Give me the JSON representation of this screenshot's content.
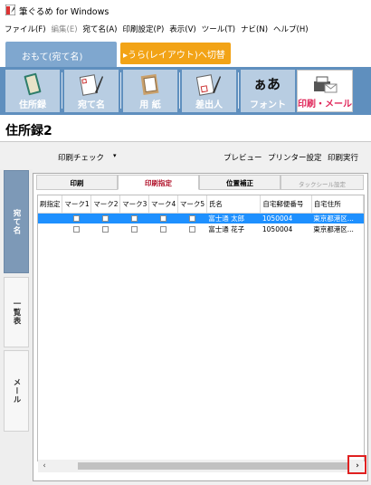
{
  "window": {
    "title": "筆ぐるめ for Windows"
  },
  "menu": [
    {
      "label": "ファイル(F)",
      "enabled": true
    },
    {
      "label": "編集(E)",
      "enabled": false
    },
    {
      "label": "宛て名(A)",
      "enabled": true
    },
    {
      "label": "印刷設定(P)",
      "enabled": true
    },
    {
      "label": "表示(V)",
      "enabled": true
    },
    {
      "label": "ツール(T)",
      "enabled": true
    },
    {
      "label": "ナビ(N)",
      "enabled": true
    },
    {
      "label": "ヘルプ(H)",
      "enabled": true
    }
  ],
  "mode_tabs": {
    "front": "おもて(宛て名)",
    "back": "▸うら(レイアウト)へ切替"
  },
  "toolbar": {
    "address_book": "住所録",
    "addressee": "宛て名",
    "paper": "用 紙",
    "sender": "差出人",
    "font": "フォント",
    "font_glyph": "ぁあ",
    "print_mail": "印刷・メール"
  },
  "book": {
    "title": "住所録2"
  },
  "subbar": {
    "print_check": "印刷チェック",
    "dropdown_arrow": "▾",
    "preview": "プレビュー",
    "printer_setting": "プリンター設定",
    "print_exec": "印刷実行"
  },
  "side_tabs": {
    "addressee": "宛て名",
    "list": "一覧表",
    "mail": "メール"
  },
  "inner_tabs": {
    "print": "印刷",
    "print_spec": "印刷指定",
    "position": "位置補正",
    "sticker": "タックシール設定"
  },
  "table": {
    "columns": [
      "刷指定",
      "マーク1",
      "マーク2",
      "マーク3",
      "マーク4",
      "マーク5",
      "氏名",
      "自宅郵便番号",
      "自宅住所"
    ],
    "rows": [
      {
        "name": "富士通 太郎",
        "zip": "1050004",
        "address": "東京都港区...",
        "selected": true
      },
      {
        "name": "富士通 花子",
        "zip": "1050004",
        "address": "東京都港区...",
        "selected": false
      }
    ]
  },
  "scrollbar": {
    "left_arrow": "‹",
    "right_arrow": "›"
  },
  "colors": {
    "accent_blue": "#5f8fbe",
    "orange": "#f2a316",
    "selection": "#1e90ff",
    "highlight_red": "#e02020"
  }
}
